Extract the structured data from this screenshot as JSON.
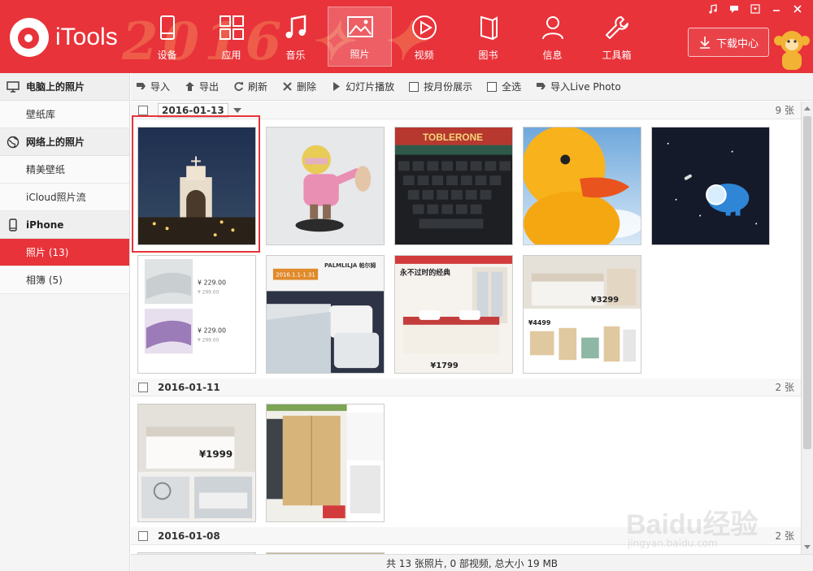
{
  "app": {
    "title": "iTools"
  },
  "nav": [
    {
      "key": "device",
      "label": "设备",
      "icon": "phone-icon"
    },
    {
      "key": "apps",
      "label": "应用",
      "icon": "apps-grid-icon"
    },
    {
      "key": "music",
      "label": "音乐",
      "icon": "music-note-icon"
    },
    {
      "key": "photos",
      "label": "照片",
      "icon": "photo-icon",
      "active": true
    },
    {
      "key": "video",
      "label": "视频",
      "icon": "play-circle-icon"
    },
    {
      "key": "books",
      "label": "图书",
      "icon": "book-icon"
    },
    {
      "key": "info",
      "label": "信息",
      "icon": "person-icon"
    },
    {
      "key": "toolbox",
      "label": "工具箱",
      "icon": "wrench-icon"
    }
  ],
  "download": {
    "label": "下载中心"
  },
  "sidebar": {
    "sections": [
      {
        "title": "电脑上的照片",
        "icon": "monitor-icon",
        "items": [
          "壁纸库"
        ]
      },
      {
        "title": "网络上的照片",
        "icon": "globe-icon",
        "items": [
          "精美壁纸",
          "iCloud照片流"
        ]
      },
      {
        "title": "iPhone",
        "icon": "smartphone-icon",
        "items": [
          "照片 (13)",
          "相簿 (5)"
        ]
      }
    ],
    "active_item": "照片 (13)"
  },
  "toolbar": {
    "import": "导入",
    "export": "导出",
    "refresh": "刷新",
    "delete": "删除",
    "slideshow": "幻灯片播放",
    "by_month": "按月份展示",
    "select_all": "全选",
    "import_live": "导入Live Photo"
  },
  "groups": [
    {
      "date": "2016-01-13",
      "count": "9 张"
    },
    {
      "date": "2016-01-11",
      "count": "2 张"
    },
    {
      "date": "2016-01-08",
      "count": "2 张"
    }
  ],
  "thumb_text": {
    "price_229a": "¥ 229.00",
    "price_299a": "¥ 299.00",
    "price_229b": "¥ 229.00",
    "price_299b": "¥ 299.00",
    "palmlilja": "PALMLILJA 帕尔姆",
    "date_badge": "2016.1.1-1.31",
    "classic": "永不过时的经典",
    "p1799": "¥1799",
    "p3299": "¥3299",
    "p4499": "¥4499",
    "p1999": "¥1999",
    "toblerone": "TOBLERONE"
  },
  "status": {
    "text": "共 13 张照片, 0 部视频, 总大小 19 MB"
  },
  "watermark": {
    "text": "Baidu经验",
    "url": "jingyan.baidu.com"
  },
  "colors": {
    "accent": "#e8333a",
    "active_nav_bg": "#ee5a5f"
  }
}
